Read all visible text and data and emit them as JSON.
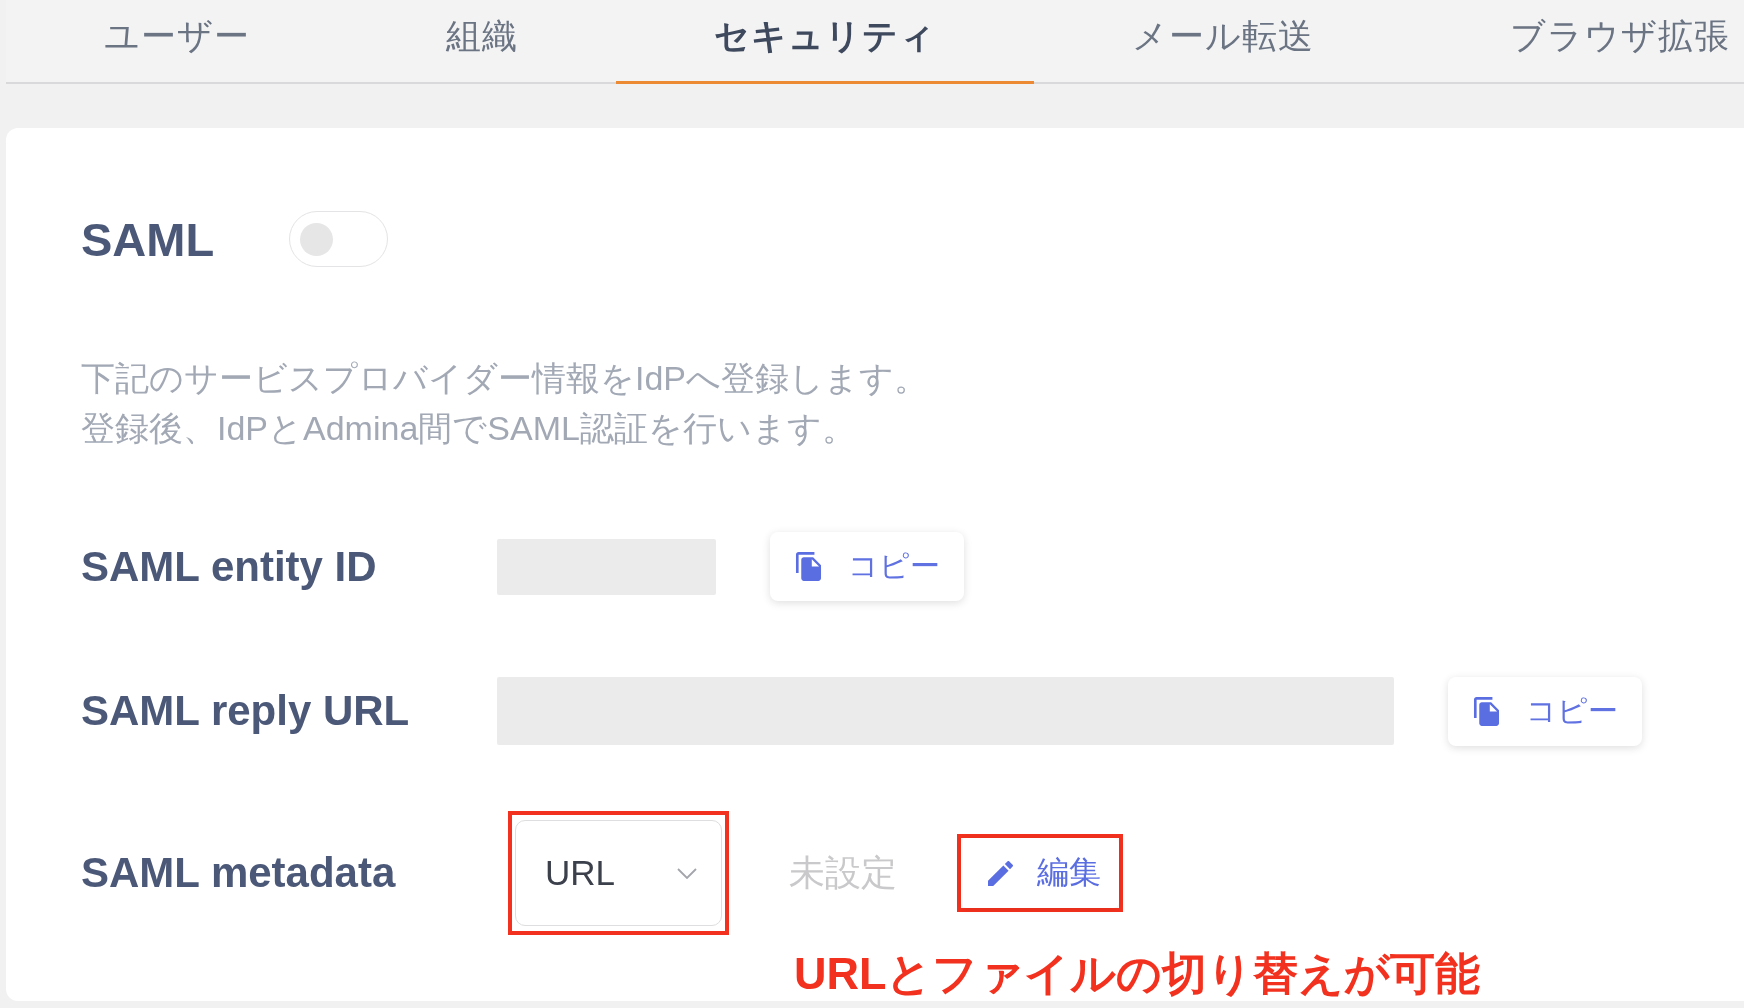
{
  "tabs": [
    {
      "label": "ユーザー",
      "selected": false
    },
    {
      "label": "組織",
      "selected": false
    },
    {
      "label": "セキュリティ",
      "selected": true
    },
    {
      "label": "メール転送",
      "selected": false
    },
    {
      "label": "ブラウザ拡張",
      "selected": false
    }
  ],
  "saml": {
    "title": "SAML",
    "enabled": false
  },
  "description": [
    "下記のサービスプロバイダー情報をIdPへ登録します。",
    "登録後、IdPとAdmina間でSAML認証を行います。"
  ],
  "rows": [
    {
      "kind": "copy",
      "label": "SAML entity ID",
      "button": "コピー"
    },
    {
      "kind": "copy",
      "label": "SAML reply URL",
      "button": "コピー"
    },
    {
      "kind": "metadata",
      "label": "SAML metadata",
      "select": {
        "value": "URL",
        "highlighted": true
      },
      "status": "未設定",
      "button": {
        "label": "編集",
        "highlighted": true
      },
      "note": "URLとファイルの切り替えが可能"
    }
  ]
}
